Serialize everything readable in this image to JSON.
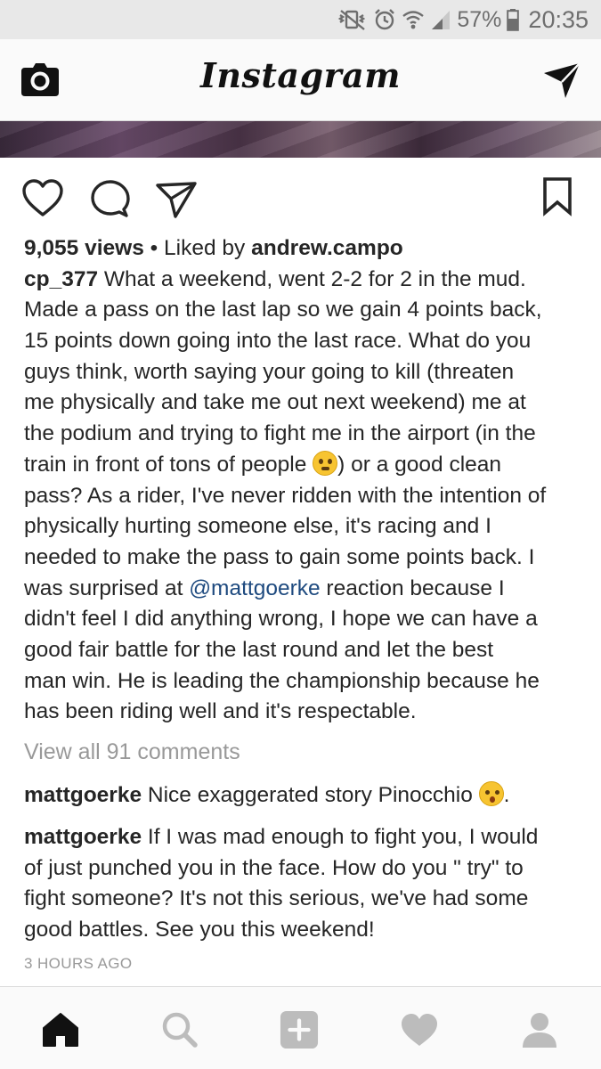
{
  "status_bar": {
    "battery_percent": "57%",
    "time": "20:35",
    "icons": [
      "vibrate-mute-icon",
      "alarm-icon",
      "wifi-icon",
      "signal-icon",
      "battery-icon"
    ]
  },
  "header": {
    "logo_text": "Instagram",
    "left_icon": "camera-icon",
    "right_icon": "direct-message-icon"
  },
  "post": {
    "actions": [
      "heart-icon",
      "comment-icon",
      "share-icon",
      "bookmark-icon"
    ],
    "views": "9,055 views",
    "liked_by_prefix": " • Liked by ",
    "liked_by_user": "andrew.campo",
    "author": "cp_377",
    "caption_lines": [
      " What a weekend, went 2-2 for 2 in the mud.",
      "Made a pass on the last lap so we gain 4 points back,",
      "15 points down going into the last race. What do you",
      "guys think, worth saying your going to kill (threaten",
      "me physically and take me out next weekend) me at",
      "the podium and trying to fight me in the airport (in the",
      "train in front of tons of people ",
      ") or a good clean",
      "pass? As a rider, I've never ridden with the intention of",
      "physically hurting someone else, it's racing and I",
      "needed to make the pass to gain some points back. I",
      "was surprised at ",
      "@mattgoerke",
      " reaction because I",
      "didn't feel I did anything wrong, I hope we can have a",
      "good fair battle for the last round and let the best",
      "man win. He is leading the championship because he",
      "has been riding well and it's respectable."
    ],
    "view_all_comments": "View all 91 comments",
    "comments": [
      {
        "user": "mattgoerke",
        "text": " Nice exaggerated story Pinocchio ",
        "suffix": "."
      },
      {
        "user": "mattgoerke",
        "lines": [
          " If I was mad enough to fight you, I would",
          "of just punched you in the face. How do you \" try\" to",
          "fight someone?  It's not this serious, we've had some",
          "good battles. See you this weekend!"
        ]
      }
    ],
    "timestamp": "3 HOURS AGO"
  },
  "bottom_nav": {
    "items": [
      "home-icon",
      "search-icon",
      "add-icon",
      "activity-heart-icon",
      "profile-icon"
    ],
    "active": "home-icon"
  }
}
